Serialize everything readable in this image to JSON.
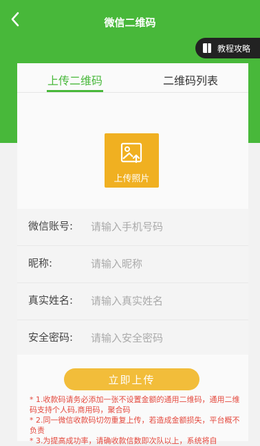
{
  "header": {
    "title": "微信二维码",
    "back_icon": "back-arrow-icon"
  },
  "tutorial": {
    "label": "教程攻略",
    "icon": "book-icon"
  },
  "tabs": [
    {
      "label": "上传二维码",
      "active": true
    },
    {
      "label": "二维码列表",
      "active": false
    }
  ],
  "upload": {
    "label": "上传照片",
    "icon": "image-upload-icon"
  },
  "form": {
    "wechat_account": {
      "label": "微信账号:",
      "placeholder": "请输入手机号码"
    },
    "nickname": {
      "label": "昵称:",
      "placeholder": "请输入昵称"
    },
    "real_name": {
      "label": "真实姓名:",
      "placeholder": "请输入真实姓名"
    },
    "security_password": {
      "label": "安全密码:",
      "placeholder": "请输入安全密码"
    }
  },
  "submit_label": "立即上传",
  "notes": [
    "* 1.收款码请务必添加一张不设置金额的通用二维码，通用二维码支持个人码,商用码，聚合码",
    "* 2.同一微信收款码切勿重复上传，若造成金额损失，平台概不负责",
    "* 3.为提高成功率，请确收款信数即次队以上，系统将自"
  ],
  "colors": {
    "primary": "#48b83a",
    "accent": "#f0b021",
    "warning_text": "#e4493e"
  }
}
